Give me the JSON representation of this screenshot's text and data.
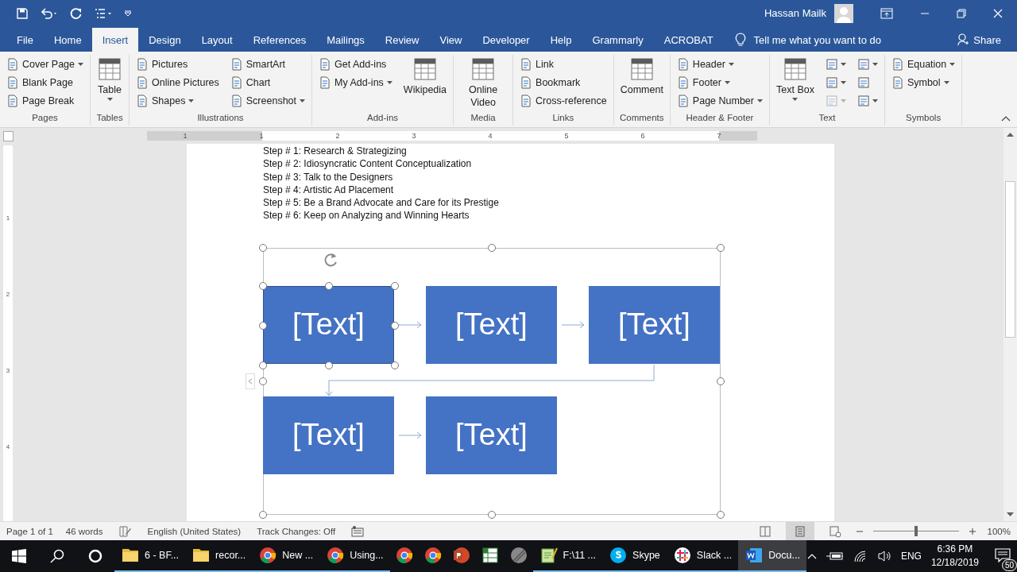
{
  "title_bar": {
    "user": "Hassan Mailk"
  },
  "tabs": [
    {
      "label": "File",
      "selected": false
    },
    {
      "label": "Home",
      "selected": false
    },
    {
      "label": "Insert",
      "selected": true
    },
    {
      "label": "Design",
      "selected": false
    },
    {
      "label": "Layout",
      "selected": false
    },
    {
      "label": "References",
      "selected": false
    },
    {
      "label": "Mailings",
      "selected": false
    },
    {
      "label": "Review",
      "selected": false
    },
    {
      "label": "View",
      "selected": false
    },
    {
      "label": "Developer",
      "selected": false
    },
    {
      "label": "Help",
      "selected": false
    },
    {
      "label": "Grammarly",
      "selected": false
    },
    {
      "label": "ACROBAT",
      "selected": false
    }
  ],
  "tell_me": "Tell me what you want to do",
  "share": "Share",
  "ribbon": {
    "groups": [
      {
        "label": "Pages",
        "columns": [
          [
            {
              "kind": "small",
              "label": "Cover Page",
              "dropdown": true,
              "disabled": false
            },
            {
              "kind": "small",
              "label": "Blank Page",
              "dropdown": false,
              "disabled": false
            },
            {
              "kind": "small",
              "label": "Page Break",
              "dropdown": false,
              "disabled": false
            }
          ]
        ]
      },
      {
        "label": "Tables",
        "columns": [
          [
            {
              "kind": "large",
              "label": "Table",
              "dropdown": true,
              "disabled": false
            }
          ]
        ]
      },
      {
        "label": "Illustrations",
        "columns": [
          [
            {
              "kind": "small",
              "label": "Pictures",
              "dropdown": false,
              "disabled": false
            },
            {
              "kind": "small",
              "label": "Online Pictures",
              "dropdown": false,
              "disabled": false
            },
            {
              "kind": "small",
              "label": "Shapes",
              "dropdown": true,
              "disabled": false
            }
          ],
          [
            {
              "kind": "small",
              "label": "SmartArt",
              "dropdown": false,
              "disabled": false
            },
            {
              "kind": "small",
              "label": "Chart",
              "dropdown": false,
              "disabled": false
            },
            {
              "kind": "small",
              "label": "Screenshot",
              "dropdown": true,
              "disabled": false
            }
          ]
        ]
      },
      {
        "label": "Add-ins",
        "columns": [
          [
            {
              "kind": "small",
              "label": "Get Add-ins",
              "dropdown": false,
              "disabled": false
            },
            {
              "kind": "small",
              "label": "My Add-ins",
              "dropdown": true,
              "disabled": false
            }
          ],
          [
            {
              "kind": "large",
              "label": "Wikipedia",
              "dropdown": false,
              "disabled": false
            }
          ]
        ]
      },
      {
        "label": "Media",
        "columns": [
          [
            {
              "kind": "large",
              "label": "Online Video",
              "dropdown": false,
              "disabled": false
            }
          ]
        ]
      },
      {
        "label": "Links",
        "columns": [
          [
            {
              "kind": "small",
              "label": "Link",
              "dropdown": false,
              "disabled": false
            },
            {
              "kind": "small",
              "label": "Bookmark",
              "dropdown": false,
              "disabled": false
            },
            {
              "kind": "small",
              "label": "Cross-reference",
              "dropdown": false,
              "disabled": false
            }
          ]
        ]
      },
      {
        "label": "Comments",
        "columns": [
          [
            {
              "kind": "large",
              "label": "Comment",
              "dropdown": false,
              "disabled": false
            }
          ]
        ]
      },
      {
        "label": "Header & Footer",
        "columns": [
          [
            {
              "kind": "small",
              "label": "Header",
              "dropdown": true,
              "disabled": false
            },
            {
              "kind": "small",
              "label": "Footer",
              "dropdown": true,
              "disabled": false
            },
            {
              "kind": "small",
              "label": "Page Number",
              "dropdown": true,
              "disabled": false
            }
          ]
        ]
      },
      {
        "label": "Text",
        "columns": [
          [
            {
              "kind": "large",
              "label": "Text Box",
              "dropdown": true,
              "disabled": false
            }
          ],
          [
            {
              "kind": "icon",
              "dropdown": true,
              "disabled": false
            },
            {
              "kind": "icon",
              "dropdown": true,
              "disabled": false
            },
            {
              "kind": "icon",
              "dropdown": true,
              "disabled": true
            }
          ],
          [
            {
              "kind": "icon",
              "dropdown": true,
              "disabled": false
            },
            {
              "kind": "icon",
              "dropdown": false,
              "disabled": false
            },
            {
              "kind": "icon",
              "dropdown": true,
              "disabled": false
            }
          ]
        ]
      },
      {
        "label": "Symbols",
        "columns": [
          [
            {
              "kind": "small",
              "label": "Equation",
              "dropdown": true,
              "disabled": false
            },
            {
              "kind": "small",
              "label": "Symbol",
              "dropdown": true,
              "disabled": false
            }
          ]
        ]
      }
    ]
  },
  "ruler": {
    "labels": [
      "1",
      "1",
      "2",
      "3",
      "4",
      "5",
      "6",
      "7"
    ]
  },
  "vertical_ruler": {
    "labels": [
      "1",
      "2",
      "3",
      "4"
    ]
  },
  "document": {
    "lines": [
      "Step # 1: Research & Strategizing",
      "Step # 2: Idiosyncratic Content Conceptualization",
      "Step # 3: Talk to the Designers",
      "Step # 4: Artistic Ad Placement",
      "Step # 5: Be a Brand Advocate and Care for its Prestige",
      "Step # 6: Keep on Analyzing and Winning Hearts"
    ]
  },
  "diagram": {
    "selected": true,
    "boxes": [
      {
        "text": "[Text]",
        "selected": true
      },
      {
        "text": "[Text]",
        "selected": false
      },
      {
        "text": "[Text]",
        "selected": false
      },
      {
        "text": "[Text]",
        "selected": false
      },
      {
        "text": "[Text]",
        "selected": false
      }
    ]
  },
  "status_bar": {
    "items": [
      "Page 1 of 1",
      "46 words",
      "English (United States)",
      "Track Changes: Off"
    ],
    "views": [
      {
        "kind": "read",
        "selected": false
      },
      {
        "kind": "print",
        "selected": true
      },
      {
        "kind": "web",
        "selected": false
      }
    ],
    "zoom": {
      "level": 0.5
    },
    "zoom_label": "100%"
  },
  "taskbar": {
    "items": [
      {
        "kind": "folder",
        "label": "6 - BF...",
        "running": true,
        "selected": false
      },
      {
        "kind": "folder",
        "label": "recor...",
        "running": true,
        "selected": false
      },
      {
        "kind": "chrome",
        "label": "New ...",
        "running": true,
        "selected": false
      },
      {
        "kind": "chrome",
        "label": "Using...",
        "running": true,
        "selected": false
      },
      {
        "kind": "chrome",
        "running": false,
        "selected": false
      },
      {
        "kind": "chrome",
        "running": false,
        "selected": false
      },
      {
        "kind": "powerpoint",
        "running": false,
        "selected": false
      },
      {
        "kind": "sheet",
        "running": false,
        "selected": false
      },
      {
        "kind": "disc",
        "running": false,
        "selected": false
      },
      {
        "kind": "notepad",
        "label": "F:\\11 ...",
        "running": true,
        "selected": false
      },
      {
        "kind": "skype",
        "label": "Skype",
        "running": true,
        "selected": false
      },
      {
        "kind": "slack",
        "label": "Slack ...",
        "running": true,
        "selected": false
      },
      {
        "kind": "word",
        "label": "Docu...",
        "running": true,
        "selected": true
      }
    ],
    "language": "ENG",
    "time": "6:36 PM",
    "date": "12/18/2019",
    "notifications": "50"
  }
}
